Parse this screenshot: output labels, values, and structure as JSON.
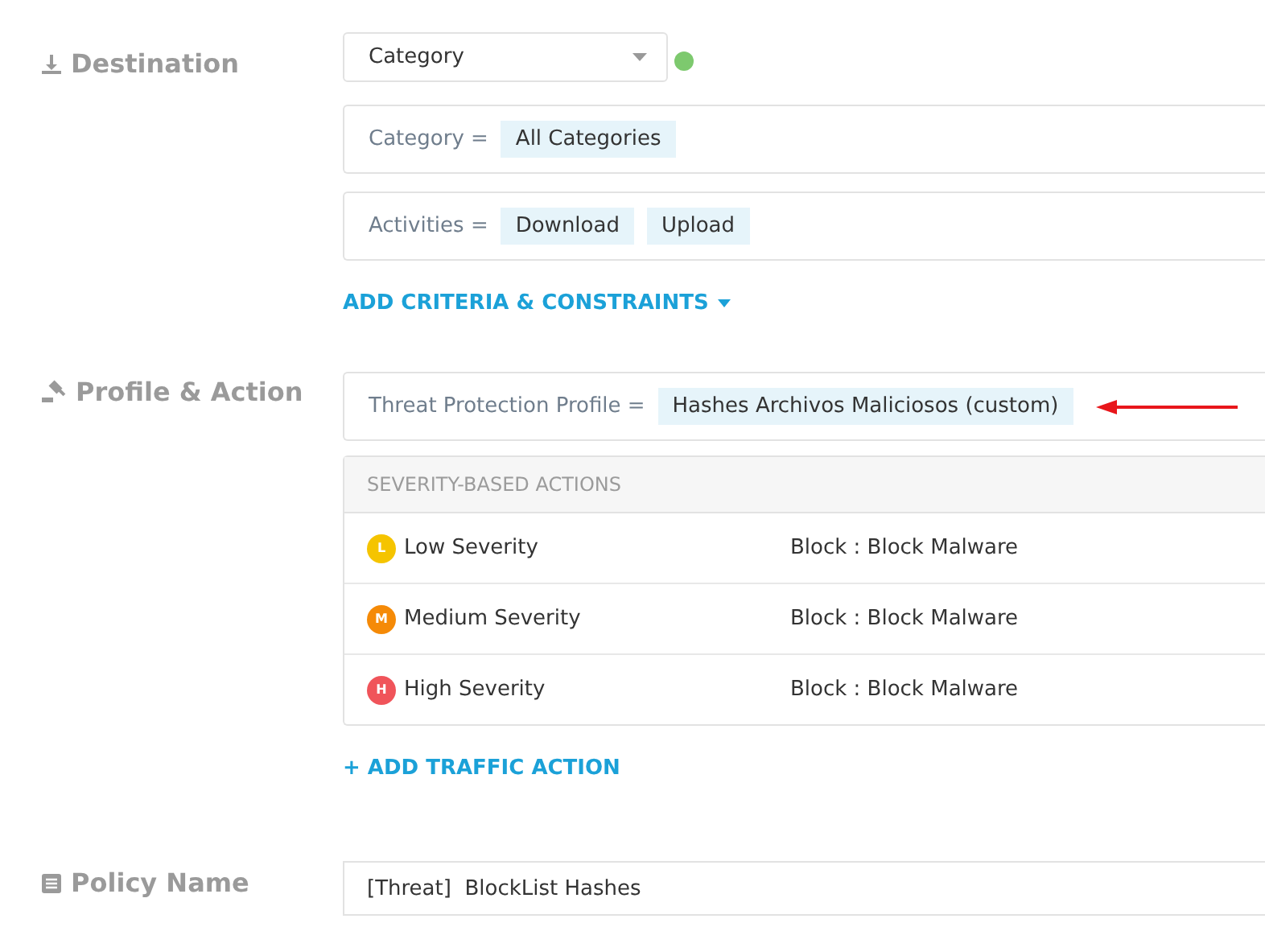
{
  "destination": {
    "label": "Destination",
    "dropdown": {
      "value": "Category"
    },
    "valid": true,
    "criteria": [
      {
        "label": "Category =",
        "values": [
          "All Categories"
        ]
      },
      {
        "label": "Activities =",
        "values": [
          "Download",
          "Upload"
        ]
      }
    ],
    "add_link": "ADD CRITERIA & CONSTRAINTS"
  },
  "profile_action": {
    "label": "Profile & Action",
    "profile": {
      "label": "Threat Protection Profile =",
      "value": "Hashes Archivos Maliciosos (custom)"
    },
    "severity_table": {
      "header": "SEVERITY-BASED ACTIONS",
      "rows": [
        {
          "badge": "L",
          "color": "#f5c400",
          "severity": "Low Severity",
          "action": "Block : Block Malware"
        },
        {
          "badge": "M",
          "color": "#f58a07",
          "severity": "Medium Severity",
          "action": "Block : Block Malware"
        },
        {
          "badge": "H",
          "color": "#f0545a",
          "severity": "High Severity",
          "action": "Block : Block Malware"
        }
      ]
    },
    "add_link": "+ ADD TRAFFIC ACTION"
  },
  "policy_name": {
    "label": "Policy Name",
    "value": "[Threat]  BlockList Hashes"
  }
}
